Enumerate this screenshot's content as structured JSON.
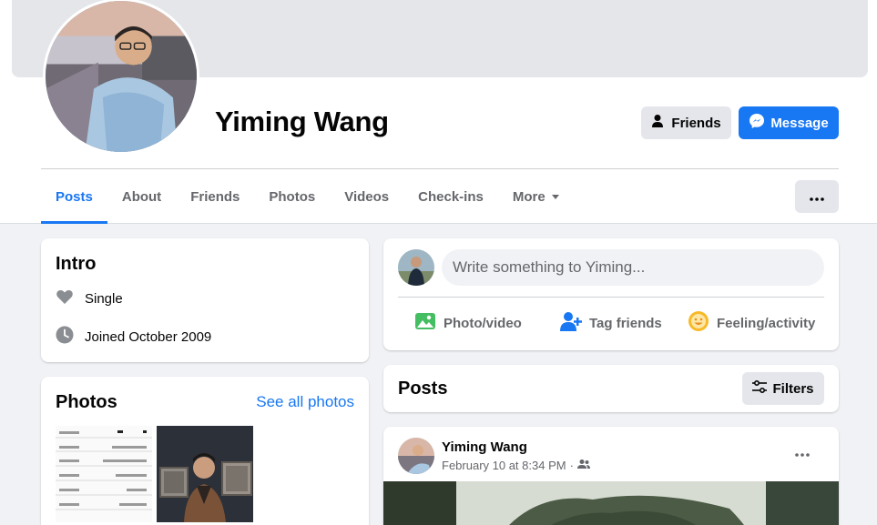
{
  "profile": {
    "name": "Yiming Wang",
    "friends_button": "Friends",
    "message_button": "Message"
  },
  "tabs": [
    {
      "label": "Posts",
      "active": true
    },
    {
      "label": "About"
    },
    {
      "label": "Friends"
    },
    {
      "label": "Photos"
    },
    {
      "label": "Videos"
    },
    {
      "label": "Check-ins"
    },
    {
      "label": "More"
    }
  ],
  "intro": {
    "title": "Intro",
    "relationship": "Single",
    "joined": "Joined October 2009"
  },
  "photos": {
    "title": "Photos",
    "see_all": "See all photos"
  },
  "composer": {
    "placeholder": "Write something to Yiming...",
    "actions": {
      "photo_video": "Photo/video",
      "tag_friends": "Tag friends",
      "feeling": "Feeling/activity"
    }
  },
  "posts": {
    "title": "Posts",
    "filters": "Filters"
  },
  "post": {
    "author": "Yiming Wang",
    "timestamp": "February 10 at 8:34 PM",
    "separator": "·"
  },
  "colors": {
    "accent": "#1877f2",
    "secondary_text": "#65676b",
    "button_gray": "#e4e6eb"
  }
}
